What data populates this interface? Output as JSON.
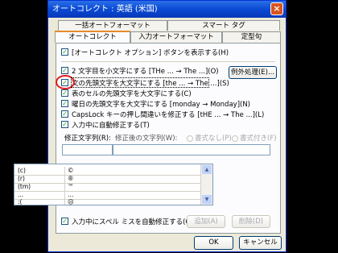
{
  "window": {
    "title": "オートコレクト : 英語 (米国)",
    "close": "×"
  },
  "tabs": {
    "row1": [
      "一括オートフォーマット",
      "スマート タグ"
    ],
    "row2": [
      "オートコレクト",
      "入力オートフォーマット",
      "定型句"
    ]
  },
  "options": {
    "show_buttons": "[オートコレクト オプション] ボタンを表示する(H)",
    "two_initials": "2 文字目を小文字にする [THe ... → The ...](O)",
    "first_letter_sentence": "文の先頭文字を大文字にする [the ... → The ...](S)",
    "first_letter_cell": "表のセルの先頭文字を大文字にする(C)",
    "day_names": "曜日の先頭文字を大文字にする [monday → Monday](N)",
    "capslock": "CapsLock キーの押し間違いを修正する [tHE ... → The ...](L)",
    "replace_text": "入力中に自動修正する(T)",
    "spell_check": "入力中にスペル ミスを自動修正する(G)"
  },
  "buttons": {
    "exceptions": "例外処理(E)...",
    "add": "追加(A)",
    "delete": "削除(D)",
    "ok": "OK",
    "cancel": "キャンセル"
  },
  "replace": {
    "replace_label": "修正文字列(R):",
    "with_label": "修正後の文字列(W):",
    "plain_text": "書式なし(P)",
    "formatted_text": "書式付き(F)"
  },
  "list_rows": [
    {
      "k": "(c)",
      "v": "©"
    },
    {
      "k": "(r)",
      "v": "®"
    },
    {
      "k": "(tm)",
      "v": "™"
    },
    {
      "k": "...",
      "v": "…"
    },
    {
      "k": ":(",
      "v": "☹"
    }
  ],
  "colors": {
    "title": "#0a4ad4",
    "check": "#21a121",
    "annotation": "#e01e1e"
  }
}
